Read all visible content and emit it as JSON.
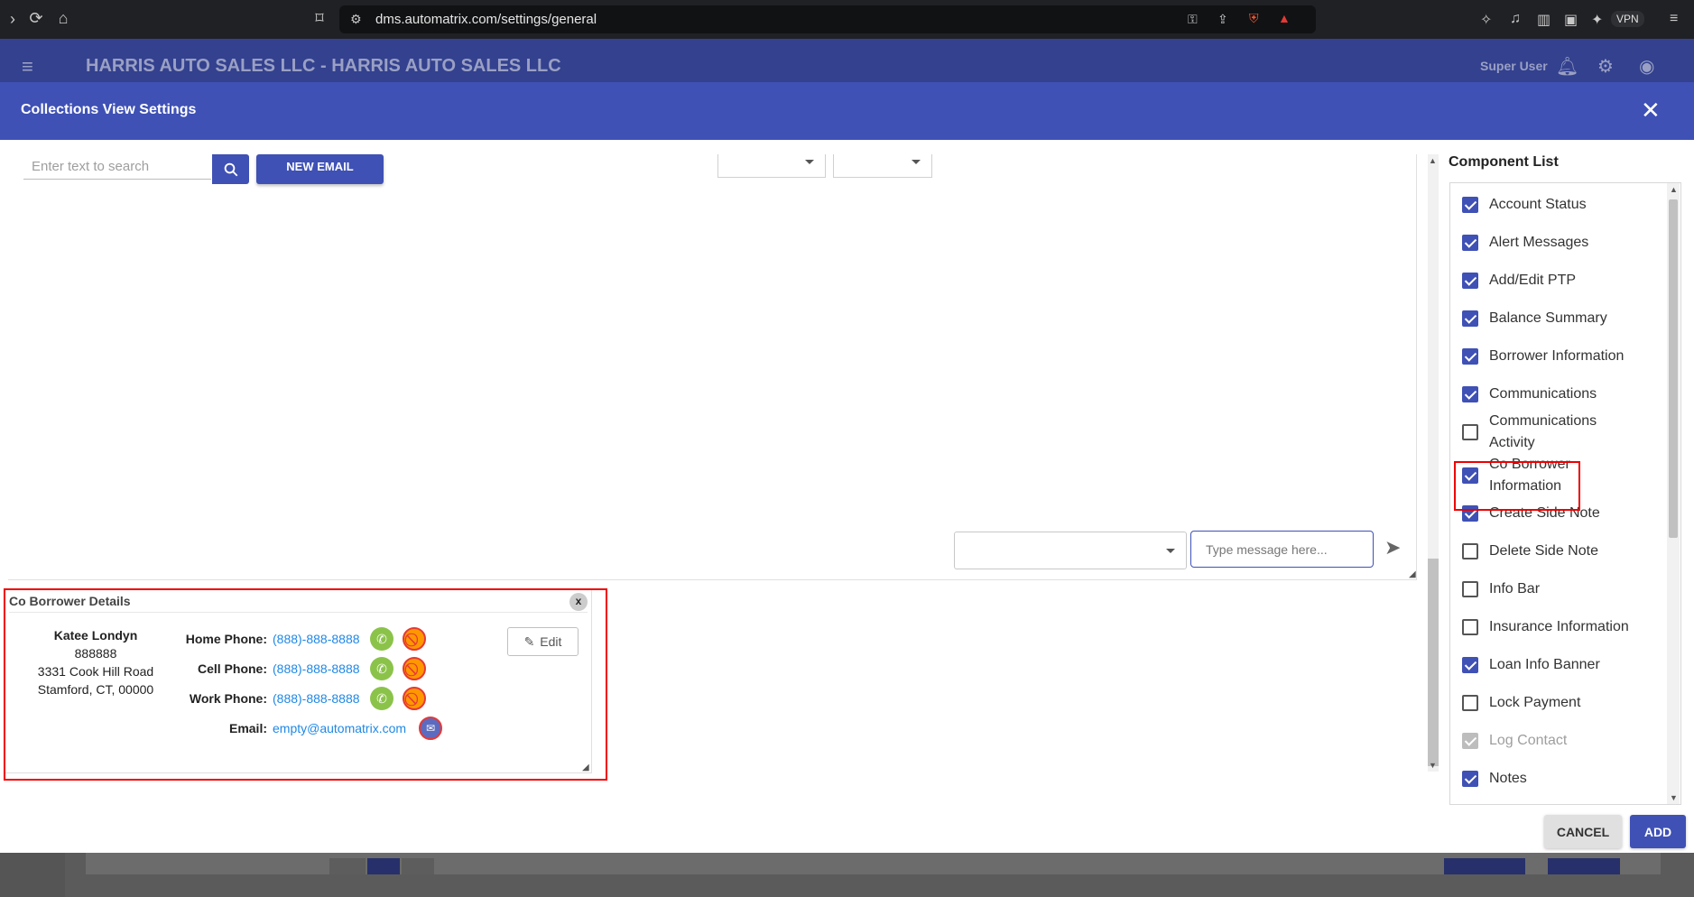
{
  "browser": {
    "url": "dms.automatrix.com/settings/general",
    "vpn_label": "VPN"
  },
  "app_header": {
    "title": "HARRIS AUTO SALES LLC - HARRIS AUTO SALES LLC",
    "user": "Super User"
  },
  "modal": {
    "title": "Collections View Settings",
    "cancel_label": "CANCEL",
    "add_label": "ADD"
  },
  "preview": {
    "search_placeholder": "Enter text to search",
    "new_email_label": "NEW EMAIL",
    "message_placeholder": "Type message here..."
  },
  "co_borrower": {
    "title": "Co Borrower Details",
    "close_label": "x",
    "name": "Katee Londyn",
    "id": "888888",
    "address_line1": "3331 Cook Hill Road",
    "address_line2": "Stamford, CT, 00000",
    "edit_label": "Edit",
    "phones": [
      {
        "label": "Home Phone:",
        "value": "(888)-888-8888"
      },
      {
        "label": "Cell Phone:",
        "value": "(888)-888-8888"
      },
      {
        "label": "Work Phone:",
        "value": "(888)-888-8888"
      }
    ],
    "email_label": "Email:",
    "email_value": "empty@automatrix.com"
  },
  "component_list": {
    "title": "Component List",
    "items": [
      {
        "label": "Account Status",
        "checked": true
      },
      {
        "label": "Alert Messages",
        "checked": true
      },
      {
        "label": "Add/Edit PTP",
        "checked": true
      },
      {
        "label": "Balance Summary",
        "checked": true
      },
      {
        "label": "Borrower Information",
        "checked": true
      },
      {
        "label": "Communications",
        "checked": true
      },
      {
        "label": "Communications Activity",
        "checked": false
      },
      {
        "label": "Co Borrower Information",
        "checked": true
      },
      {
        "label": "Create Side Note",
        "checked": true
      },
      {
        "label": "Delete Side Note",
        "checked": false
      },
      {
        "label": "Info Bar",
        "checked": false
      },
      {
        "label": "Insurance Information",
        "checked": false
      },
      {
        "label": "Loan Info Banner",
        "checked": true
      },
      {
        "label": "Lock Payment",
        "checked": false
      },
      {
        "label": "Log Contact",
        "checked": true,
        "disabled": true
      },
      {
        "label": "Notes",
        "checked": true
      }
    ]
  },
  "colors": {
    "primary": "#3f51b5",
    "header_dark": "#33418e",
    "highlight": "#ee0000",
    "link": "#1e88e5"
  }
}
